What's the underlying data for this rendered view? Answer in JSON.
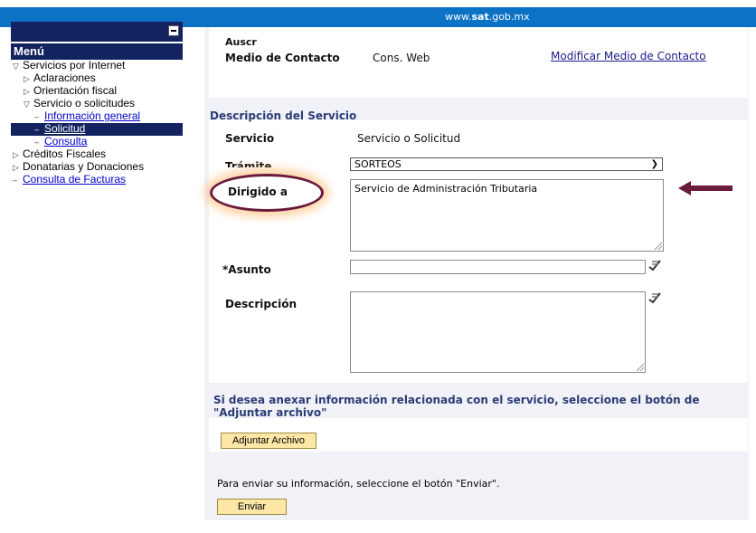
{
  "topbar": {
    "url_prefix": "www.",
    "url_bold": "sat",
    "url_suffix": ".gob.mx"
  },
  "sidebar": {
    "title": "Menú",
    "items": [
      {
        "label": "Servicios por Internet",
        "marker": "▽"
      },
      {
        "label": "Aclaraciones",
        "marker": "▷"
      },
      {
        "label": "Orientación fiscal",
        "marker": "▷"
      },
      {
        "label": "Servicio o solicitudes",
        "marker": "▽"
      },
      {
        "label": "Información general",
        "marker": "–"
      },
      {
        "label": "Solicitud",
        "marker": "–"
      },
      {
        "label": "Consulta",
        "marker": "–"
      },
      {
        "label": "Créditos Fiscales",
        "marker": "▷"
      },
      {
        "label": "Donatarias y Donaciones",
        "marker": "▷"
      },
      {
        "label": "Consulta de Facturas",
        "marker": "–"
      }
    ]
  },
  "contact": {
    "cut_label": "Auscr",
    "medio_label": "Medio de Contacto",
    "medio_value": "Cons. Web",
    "modify_link": "Modificar Medio de Contacto"
  },
  "service": {
    "section_title": "Descripción del Servicio",
    "servicio_label": "Servicio",
    "servicio_value": "Servicio o Solicitud",
    "tramite_label": "Trámite",
    "tramite_value": "SORTEOS",
    "dirigido_label": "Dirigido a",
    "dirigido_value": "Servicio de Administración Tributaria",
    "asunto_label": "*Asunto",
    "asunto_value": "",
    "descripcion_label": "Descripción",
    "descripcion_value": ""
  },
  "attach": {
    "text": "Si desea anexar información relacionada con el servicio, seleccione el botón de \"Adjuntar archivo\"",
    "button": "Adjuntar Archivo"
  },
  "send": {
    "text": "Para enviar su información, seleccione el botón \"Enviar\".",
    "button": "Enviar"
  },
  "colors": {
    "topbar": "#0b72c4",
    "menu_bg": "#13235f",
    "panel_bg": "#f0f2f7",
    "button_bg": "#fde7a7",
    "highlight": "#6a1a3a"
  }
}
